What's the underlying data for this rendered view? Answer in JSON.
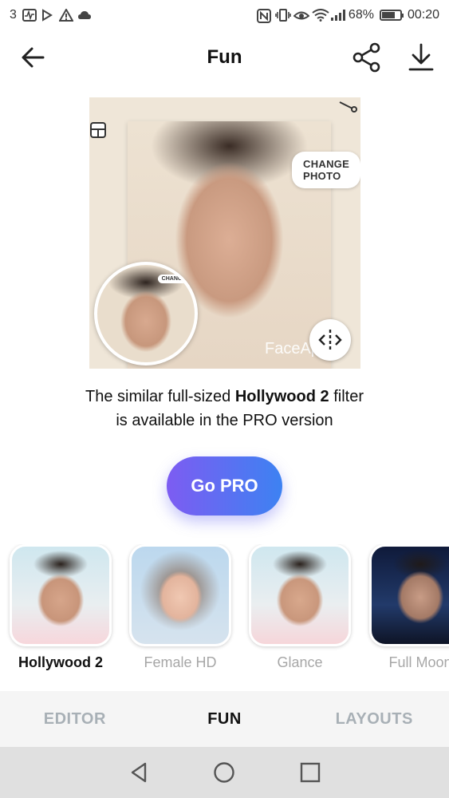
{
  "status_bar": {
    "notif_count": "3",
    "battery": "68%",
    "time": "00:20",
    "battery_level": 0.68
  },
  "header": {
    "title": "Fun",
    "back_icon": "arrow-left-icon",
    "share_icon": "share-icon",
    "download_icon": "download-icon"
  },
  "preview": {
    "change_photo": "CHANGE PHOTO",
    "mini_change": "CHANGE",
    "watermark": "FaceApp"
  },
  "info": {
    "line1_prefix": "The similar full-sized ",
    "filter_name": "Hollywood 2",
    "line1_suffix": " filter",
    "line2": "is available in the PRO version"
  },
  "cta": {
    "label": "Go PRO",
    "gradient_start": "#7d5cf2",
    "gradient_end": "#3d82f2"
  },
  "filters": [
    {
      "label": "Hollywood 2",
      "selected": true
    },
    {
      "label": "Female HD",
      "selected": false
    },
    {
      "label": "Glance",
      "selected": false
    },
    {
      "label": "Full Moon",
      "selected": false
    }
  ],
  "tabs": [
    {
      "label": "EDITOR",
      "active": false
    },
    {
      "label": "FUN",
      "active": true
    },
    {
      "label": "LAYOUTS",
      "active": false
    }
  ],
  "system_nav": [
    "back-triangle-icon",
    "home-circle-icon",
    "recents-square-icon"
  ]
}
